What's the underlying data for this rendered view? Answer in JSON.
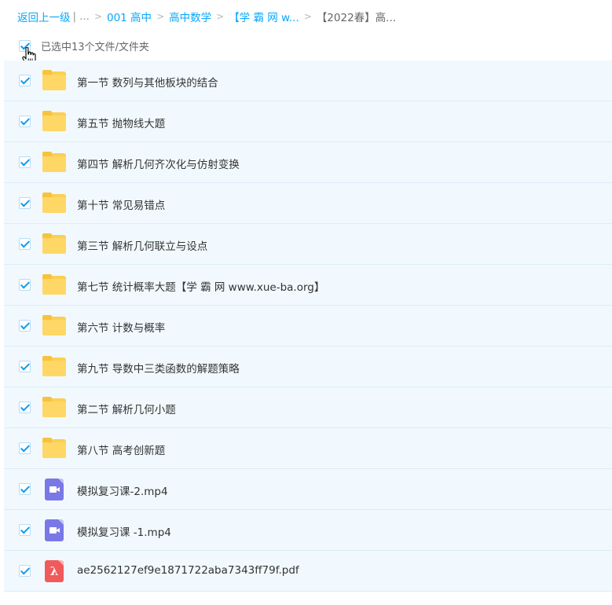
{
  "breadcrumb": {
    "back": "返回上一级",
    "ellipsis": "...",
    "items": [
      "001 高中",
      "高中数学",
      "【学 霸 网 w..."
    ],
    "current": "【2022春】高...",
    "separator": ">"
  },
  "selection": {
    "text": "已选中13个文件/文件夹",
    "all_checked": true
  },
  "files": [
    {
      "name": "第一节 数列与其他板块的结合",
      "type": "folder",
      "checked": true
    },
    {
      "name": "第五节 抛物线大题",
      "type": "folder",
      "checked": true
    },
    {
      "name": "第四节 解析几何齐次化与仿射变换",
      "type": "folder",
      "checked": true
    },
    {
      "name": "第十节 常见易错点",
      "type": "folder",
      "checked": true
    },
    {
      "name": "第三节 解析几何联立与设点",
      "type": "folder",
      "checked": true
    },
    {
      "name": "第七节 统计概率大题【学 霸 网 www.xue-ba.org】",
      "type": "folder",
      "checked": true
    },
    {
      "name": "第六节 计数与概率",
      "type": "folder",
      "checked": true
    },
    {
      "name": "第九节 导数中三类函数的解题策略",
      "type": "folder",
      "checked": true
    },
    {
      "name": "第二节 解析几何小题",
      "type": "folder",
      "checked": true
    },
    {
      "name": "第八节 高考创新题",
      "type": "folder",
      "checked": true
    },
    {
      "name": "模拟复习课-2.mp4",
      "type": "video",
      "checked": true
    },
    {
      "name": "模拟复习课 -1.mp4",
      "type": "video",
      "checked": true
    },
    {
      "name": "ae2562127ef9e1871722aba7343ff79f.pdf",
      "type": "pdf",
      "checked": true
    }
  ],
  "colors": {
    "link": "#06a7ff",
    "row_background": "#f1f9fe",
    "checkbox_mark": "#0d9bf0",
    "folder": "#ffd766",
    "video_icon": "#7a78e6",
    "pdf_icon": "#f05a5a"
  }
}
